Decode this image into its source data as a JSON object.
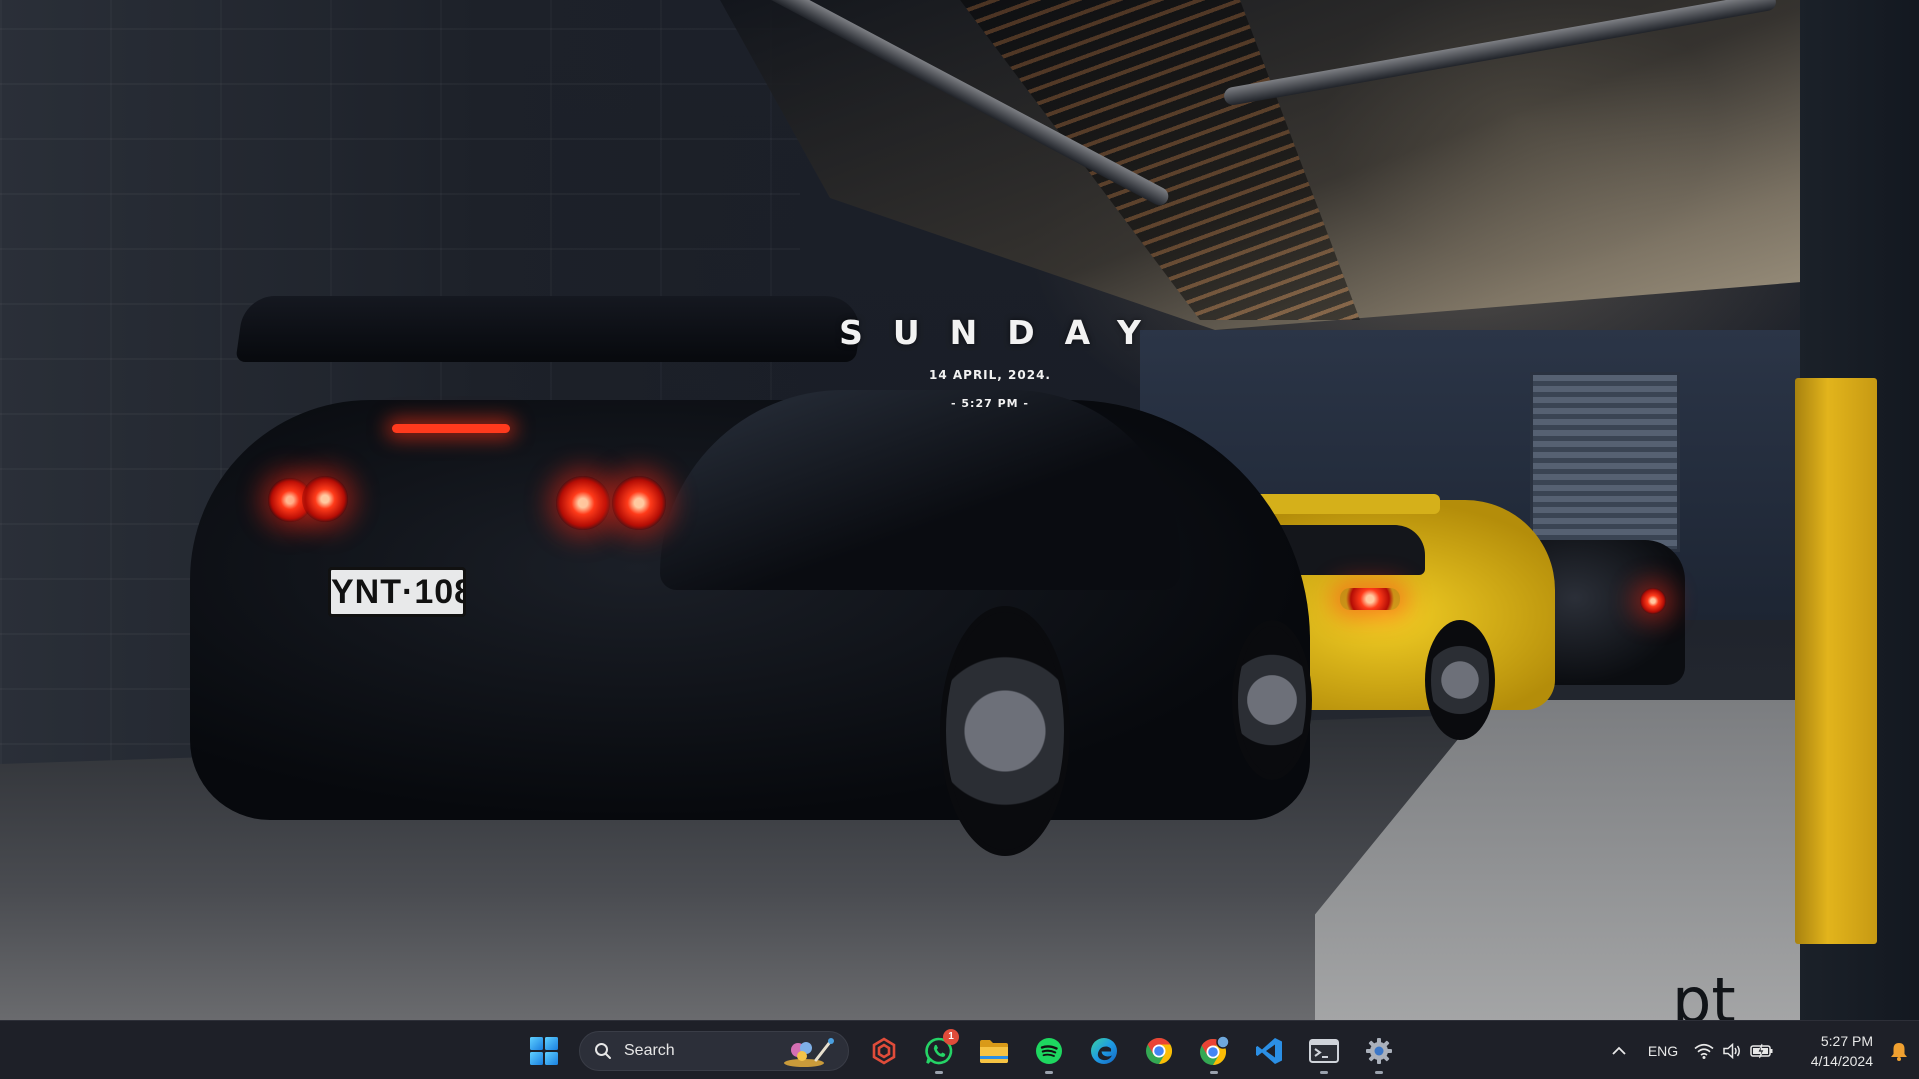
{
  "desktop": {
    "widget": {
      "day": "SUNDAY",
      "date": "14 APRIL, 2024.",
      "time": "- 5:27 PM -"
    },
    "corner_mark": "pt",
    "license_plate": "YNT·108"
  },
  "taskbar": {
    "start_icon": "windows-start-icon",
    "search": {
      "label": "Search",
      "icon": "search-icon"
    },
    "apps": [
      {
        "name": "chatgpt",
        "icon": "chatgpt-icon",
        "color": "#e04c3a"
      },
      {
        "name": "whatsapp",
        "icon": "whatsapp-icon",
        "color": "#25d366",
        "badge": "1"
      },
      {
        "name": "file-explorer",
        "icon": "folder-icon",
        "color": "#f6c343"
      },
      {
        "name": "spotify",
        "icon": "spotify-icon",
        "color": "#1ed760"
      },
      {
        "name": "edge",
        "icon": "edge-icon",
        "color": "#1f9be3"
      },
      {
        "name": "chrome",
        "icon": "chrome-icon",
        "color": "#ea4335"
      },
      {
        "name": "chrome-profile",
        "icon": "chrome-profile-icon",
        "color": "#34a853"
      },
      {
        "name": "vscode",
        "icon": "vscode-icon",
        "color": "#2b8fe5"
      },
      {
        "name": "terminal",
        "icon": "terminal-icon",
        "color": "#cfd3da"
      },
      {
        "name": "settings",
        "icon": "gear-icon",
        "color": "#aab0bb"
      }
    ],
    "tray": {
      "language": "ENG",
      "time": "5:27 PM",
      "date": "4/14/2024"
    }
  }
}
